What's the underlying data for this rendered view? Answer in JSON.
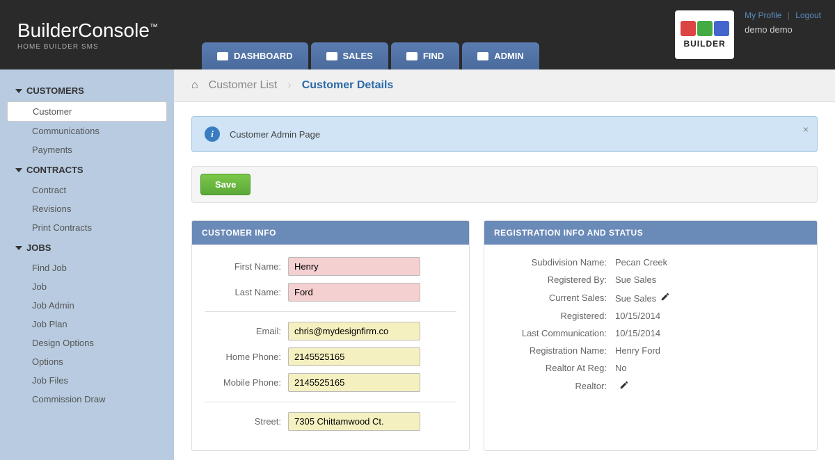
{
  "logo": {
    "main": "BuilderConsole",
    "sup": "™",
    "sub": "HOME BUILDER SMS"
  },
  "nav": {
    "dashboard": "DASHBOARD",
    "sales": "SALES",
    "find": "FIND",
    "admin": "ADMIN"
  },
  "builderLogo": "BUILDER",
  "userLinks": {
    "profile": "My Profile",
    "logout": "Logout"
  },
  "userName": "demo demo",
  "sidebar": {
    "groups": [
      {
        "title": "CUSTOMERS",
        "items": [
          "Customer",
          "Communications",
          "Payments"
        ]
      },
      {
        "title": "CONTRACTS",
        "items": [
          "Contract",
          "Revisions",
          "Print Contracts"
        ]
      },
      {
        "title": "JOBS",
        "items": [
          "Find Job",
          "Job",
          "Job Admin",
          "Job Plan",
          "Design Options",
          "Options",
          "Job Files",
          "Commission Draw"
        ]
      }
    ]
  },
  "breadcrumb": {
    "list": "Customer List",
    "details": "Customer Details"
  },
  "banner": {
    "text": "Customer Admin Page"
  },
  "toolbar": {
    "save": "Save"
  },
  "customerInfo": {
    "header": "CUSTOMER INFO",
    "firstName": {
      "label": "First Name:",
      "value": "Henry"
    },
    "lastName": {
      "label": "Last Name:",
      "value": "Ford"
    },
    "email": {
      "label": "Email:",
      "value": "chris@mydesignfirm.co"
    },
    "homePhone": {
      "label": "Home Phone:",
      "value": "2145525165"
    },
    "mobilePhone": {
      "label": "Mobile Phone:",
      "value": "2145525165"
    },
    "street": {
      "label": "Street:",
      "value": "7305 Chittamwood Ct."
    }
  },
  "registration": {
    "header": "REGISTRATION INFO AND STATUS",
    "subdivision": {
      "label": "Subdivision Name:",
      "value": "Pecan Creek"
    },
    "registeredBy": {
      "label": "Registered By:",
      "value": "Sue Sales"
    },
    "currentSales": {
      "label": "Current Sales:",
      "value": "Sue Sales"
    },
    "registered": {
      "label": "Registered:",
      "value": "10/15/2014"
    },
    "lastComm": {
      "label": "Last Communication:",
      "value": "10/15/2014"
    },
    "regName": {
      "label": "Registration Name:",
      "value": "Henry Ford"
    },
    "realtorAtReg": {
      "label": "Realtor At Reg:",
      "value": "No"
    },
    "realtor": {
      "label": "Realtor:",
      "value": ""
    }
  }
}
